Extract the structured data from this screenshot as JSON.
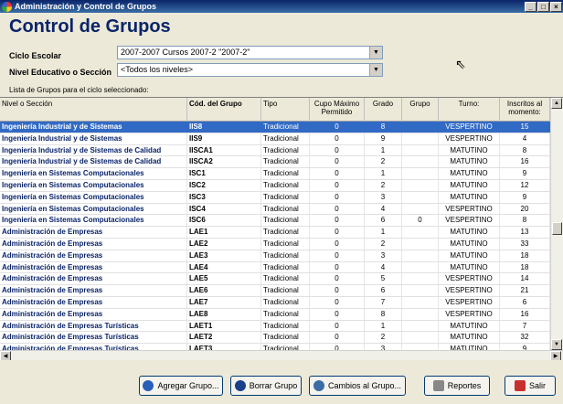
{
  "window": {
    "title": "Administración y Control de Grupos",
    "min": "_",
    "max": "□",
    "close": "×"
  },
  "form_title": "Control de Grupos",
  "ciclo": {
    "label": "Ciclo Escolar",
    "value": "2007-2007 Cursos 2007-2 \"2007-2\""
  },
  "nivel": {
    "label": "Nivel Educativo o Sección",
    "value": "<Todos los niveles>"
  },
  "list_label": "Lista de Grupos para el ciclo seleccionado:",
  "columns": [
    "Nivel o Sección",
    "Cód. del Grupo",
    "Tipo",
    "Cupo Máximo Permitido",
    "Grado",
    "Grupo",
    "Turno:",
    "Inscritos al momento:"
  ],
  "rows": [
    [
      "Ingeniería Industrial y de Sistemas",
      "IIS8",
      "Tradicional",
      "0",
      "8",
      "",
      "VESPERTINO",
      "15"
    ],
    [
      "Ingeniería Industrial y de Sistemas",
      "IIS9",
      "Tradicional",
      "0",
      "9",
      "",
      "VESPERTINO",
      "4"
    ],
    [
      "Ingeniería Industrial y de Sistemas de Calidad",
      "IISCA1",
      "Tradicional",
      "0",
      "1",
      "",
      "MATUTINO",
      "8"
    ],
    [
      "Ingeniería Industrial y de Sistemas de Calidad",
      "IISCA2",
      "Tradicional",
      "0",
      "2",
      "",
      "MATUTINO",
      "16"
    ],
    [
      "Ingeniería en Sistemas Computacionales",
      "ISC1",
      "Tradicional",
      "0",
      "1",
      "",
      "MATUTINO",
      "9"
    ],
    [
      "Ingeniería en Sistemas Computacionales",
      "ISC2",
      "Tradicional",
      "0",
      "2",
      "",
      "MATUTINO",
      "12"
    ],
    [
      "Ingeniería en Sistemas Computacionales",
      "ISC3",
      "Tradicional",
      "0",
      "3",
      "",
      "MATUTINO",
      "9"
    ],
    [
      "Ingeniería en Sistemas Computacionales",
      "ISC4",
      "Tradicional",
      "0",
      "4",
      "",
      "VESPERTINO",
      "20"
    ],
    [
      "Ingeniería en Sistemas Computacionales",
      "ISC6",
      "Tradicional",
      "0",
      "6",
      "0",
      "VESPERTINO",
      "8"
    ],
    [
      "Administración de Empresas",
      "LAE1",
      "Tradicional",
      "0",
      "1",
      "",
      "MATUTINO",
      "13"
    ],
    [
      "Administración de Empresas",
      "LAE2",
      "Tradicional",
      "0",
      "2",
      "",
      "MATUTINO",
      "33"
    ],
    [
      "Administración de Empresas",
      "LAE3",
      "Tradicional",
      "0",
      "3",
      "",
      "MATUTINO",
      "18"
    ],
    [
      "Administración de Empresas",
      "LAE4",
      "Tradicional",
      "0",
      "4",
      "",
      "MATUTINO",
      "18"
    ],
    [
      "Administración de Empresas",
      "LAE5",
      "Tradicional",
      "0",
      "5",
      "",
      "VESPERTINO",
      "14"
    ],
    [
      "Administración de Empresas",
      "LAE6",
      "Tradicional",
      "0",
      "6",
      "",
      "VESPERTINO",
      "21"
    ],
    [
      "Administración de Empresas",
      "LAE7",
      "Tradicional",
      "0",
      "7",
      "",
      "VESPERTINO",
      "6"
    ],
    [
      "Administración de Empresas",
      "LAE8",
      "Tradicional",
      "0",
      "8",
      "",
      "VESPERTINO",
      "16"
    ],
    [
      "Administración de Empresas Turísticas",
      "LAET1",
      "Tradicional",
      "0",
      "1",
      "",
      "MATUTINO",
      "7"
    ],
    [
      "Administración de Empresas Turísticas",
      "LAET2",
      "Tradicional",
      "0",
      "2",
      "",
      "MATUTINO",
      "32"
    ],
    [
      "Administración de Empresas Turísticas",
      "LAET3",
      "Tradicional",
      "0",
      "3",
      "",
      "MATUTINO",
      "9"
    ]
  ],
  "selected_row": 0,
  "buttons": {
    "add": "Agregar Grupo...",
    "delete": "Borrar Grupo",
    "change": "Cambios al Grupo...",
    "reports": "Reportes",
    "exit": "Salir"
  },
  "colors": {
    "title_blue": "#0a246a",
    "selection": "#316ac5"
  }
}
